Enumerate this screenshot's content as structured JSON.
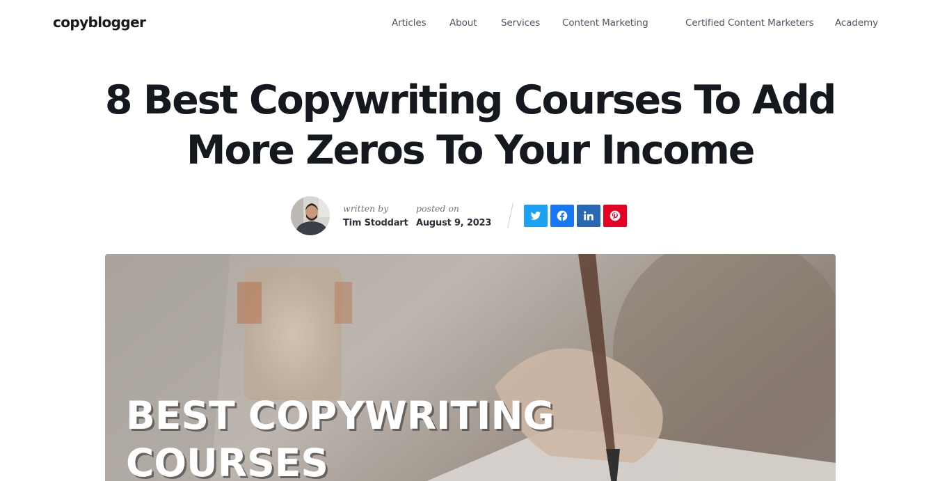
{
  "site": {
    "logo_text": "copyblogger"
  },
  "nav": {
    "items": [
      {
        "label": "Articles"
      },
      {
        "label": "About"
      },
      {
        "label": "Services"
      },
      {
        "label": "Content Marketing"
      },
      {
        "label": "Certified Content Marketers"
      },
      {
        "label": "Academy"
      }
    ]
  },
  "article": {
    "title_line1": "8 Best Copywriting Courses To Add",
    "title_line2": "More Zeros To Your Income",
    "author_label": "written by",
    "author_name": "Tim Stoddart",
    "date_label": "posted on",
    "date": "August 9, 2023"
  },
  "share": {
    "buttons": [
      {
        "icon": "twitter-icon",
        "color": "#1da1f2"
      },
      {
        "icon": "facebook-icon",
        "color": "#1877f2"
      },
      {
        "icon": "linkedin-icon",
        "color": "#2867b2"
      },
      {
        "icon": "pinterest-icon",
        "color": "#e60023"
      }
    ]
  },
  "hero": {
    "heading_line1": "BEST COPYWRITING",
    "heading_line2": "COURSES"
  },
  "colors": {
    "text": "#15191f",
    "nav_text": "#4a5868",
    "meta_label": "#6b7580"
  }
}
